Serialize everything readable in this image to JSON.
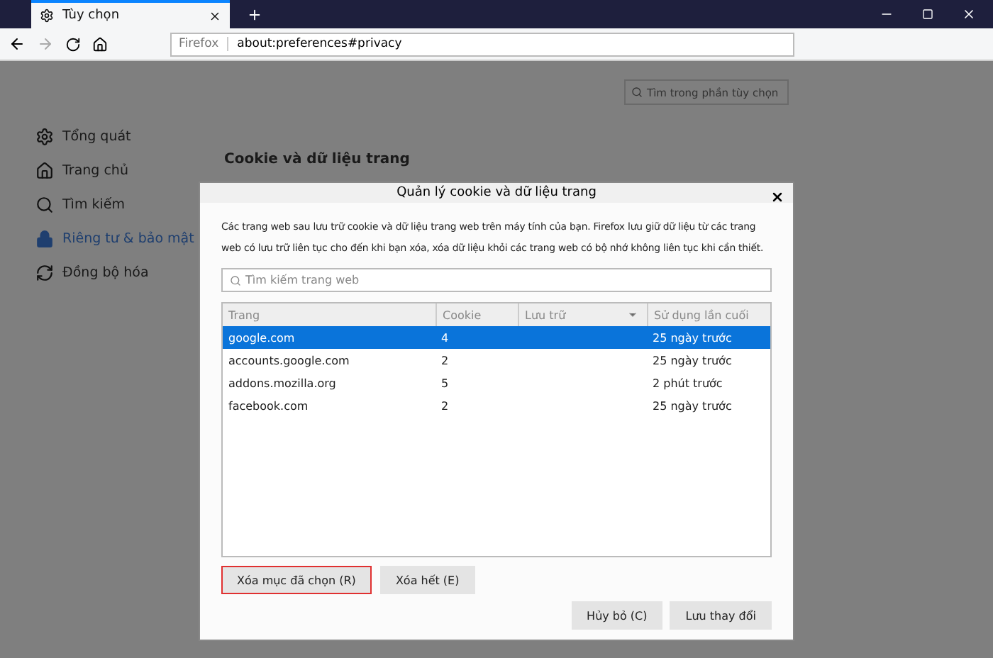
{
  "tabs": [
    {
      "label": "Tùy chọn",
      "selected": true
    }
  ],
  "address": {
    "identity": "Firefox",
    "url": "about:preferences#privacy"
  },
  "search": {
    "placeholder": "Tìm trong phần tùy chọn"
  },
  "sidebar": {
    "items": [
      {
        "label": "Tổng quát",
        "kind": "gear",
        "selected": false
      },
      {
        "label": "Trang chủ",
        "kind": "home",
        "selected": false
      },
      {
        "label": "Tìm kiếm",
        "kind": "search",
        "selected": false
      },
      {
        "label": "Riêng tư & bảo mật",
        "kind": "lock",
        "selected": true
      },
      {
        "label": "Đồng bộ hóa",
        "kind": "sync",
        "selected": false
      }
    ]
  },
  "section_title": "Cookie và dữ liệu trang",
  "dialog": {
    "title": "Quản lý cookie và dữ liệu trang",
    "description": "Các trang web sau lưu trữ cookie và dữ liệu trang web trên máy tính của bạn. Firefox lưu giữ dữ liệu từ các trang web có lưu trữ liên tục cho đến khi bạn xóa, xóa dữ liệu khỏi các trang web có bộ nhớ không liên tục khi cần thiết.",
    "search": {
      "placeholder": "Tìm kiếm trang web"
    },
    "table": {
      "columns": [
        "Trang",
        "Cookie",
        "Lưu trữ",
        "Sử dụng lần cuối"
      ],
      "rows": [
        {
          "cells": [
            "google.com",
            "4",
            "",
            "25 ngày trước"
          ],
          "selected": true
        },
        {
          "cells": [
            "accounts.google.com",
            "2",
            "",
            "25 ngày trước"
          ],
          "selected": false
        },
        {
          "cells": [
            "addons.mozilla.org",
            "5",
            "",
            "2 phút trước"
          ],
          "selected": false
        },
        {
          "cells": [
            "facebook.com",
            "2",
            "",
            "25 ngày trước"
          ],
          "selected": false
        }
      ]
    },
    "actions": [
      {
        "label": "Xóa mục đã chọn (R)",
        "highlighted": true
      },
      {
        "label": "Xóa hết (E)",
        "highlighted": false
      }
    ],
    "buttons": [
      {
        "label": "Hủy bỏ (C)"
      },
      {
        "label": "Lưu thay đổi"
      }
    ]
  }
}
